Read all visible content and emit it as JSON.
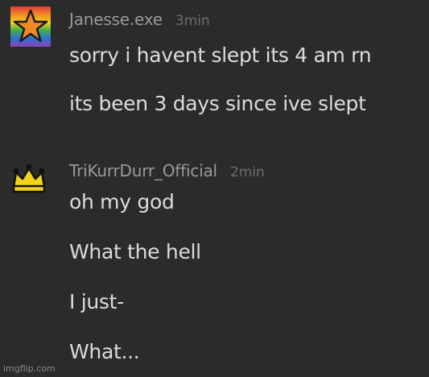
{
  "messages": [
    {
      "author": "Janesse.exe",
      "time": "3min",
      "avatar_icon": "rainbow-star-icon",
      "lines": [
        "sorry i havent slept its 4 am rn",
        "its been 3 days since ive slept"
      ]
    },
    {
      "author": "TriKurrDurr_Official",
      "time": "2min",
      "avatar_icon": "crown-icon",
      "lines": [
        "oh my god",
        "What the hell",
        "I just-",
        "What..."
      ]
    }
  ],
  "watermark": "imgflip.com",
  "colors": {
    "background": "#2b2b2b",
    "author": "#9a9a9a",
    "timestamp": "#6f6f6f",
    "message_text": "#dcdcdc",
    "star": "#f08a24",
    "crown": "#f2d21b"
  }
}
